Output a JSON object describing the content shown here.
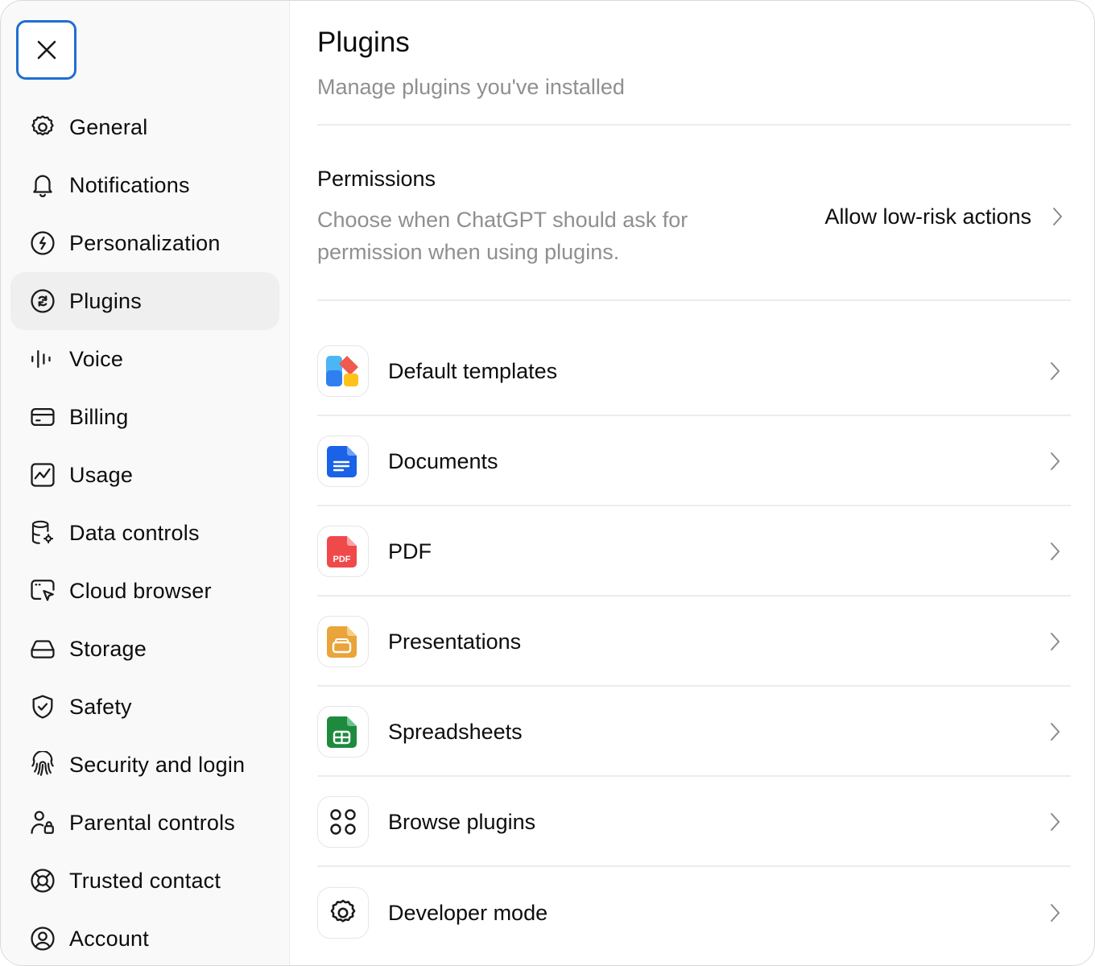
{
  "sidebar": {
    "close_icon": "close-icon",
    "items": [
      {
        "label": "General",
        "icon": "gear-icon"
      },
      {
        "label": "Notifications",
        "icon": "bell-icon"
      },
      {
        "label": "Personalization",
        "icon": "clock-icon"
      },
      {
        "label": "Plugins",
        "icon": "plugin-icon",
        "active": true
      },
      {
        "label": "Voice",
        "icon": "waveform-icon"
      },
      {
        "label": "Billing",
        "icon": "card-icon"
      },
      {
        "label": "Usage",
        "icon": "chart-icon"
      },
      {
        "label": "Data controls",
        "icon": "database-icon"
      },
      {
        "label": "Cloud browser",
        "icon": "browser-icon"
      },
      {
        "label": "Storage",
        "icon": "drive-icon"
      },
      {
        "label": "Safety",
        "icon": "shield-icon"
      },
      {
        "label": "Security and login",
        "icon": "fingerprint-icon"
      },
      {
        "label": "Parental controls",
        "icon": "parent-lock-icon"
      },
      {
        "label": "Trusted contact",
        "icon": "lifebuoy-icon"
      },
      {
        "label": "Account",
        "icon": "user-circle-icon"
      }
    ]
  },
  "main": {
    "title": "Plugins",
    "subtitle": "Manage plugins you've installed",
    "permissions": {
      "title": "Permissions",
      "description": "Choose when ChatGPT should ask for permission when using plugins.",
      "value": "Allow low-risk actions"
    },
    "rows": [
      {
        "label": "Default templates",
        "icon": "templates-icon"
      },
      {
        "label": "Documents",
        "icon": "document-icon"
      },
      {
        "label": "PDF",
        "icon": "pdf-icon",
        "icon_text": "PDF"
      },
      {
        "label": "Presentations",
        "icon": "presentation-icon"
      },
      {
        "label": "Spreadsheets",
        "icon": "spreadsheet-icon"
      },
      {
        "label": "Browse plugins",
        "icon": "grid-circles-icon"
      },
      {
        "label": "Developer mode",
        "icon": "gear-icon"
      }
    ]
  },
  "colors": {
    "accent_focus": "#1f6fd1",
    "documents": "#1a62e8",
    "pdf": "#f0494a",
    "presentations": "#e9a43a",
    "spreadsheets": "#1e8a3e"
  }
}
